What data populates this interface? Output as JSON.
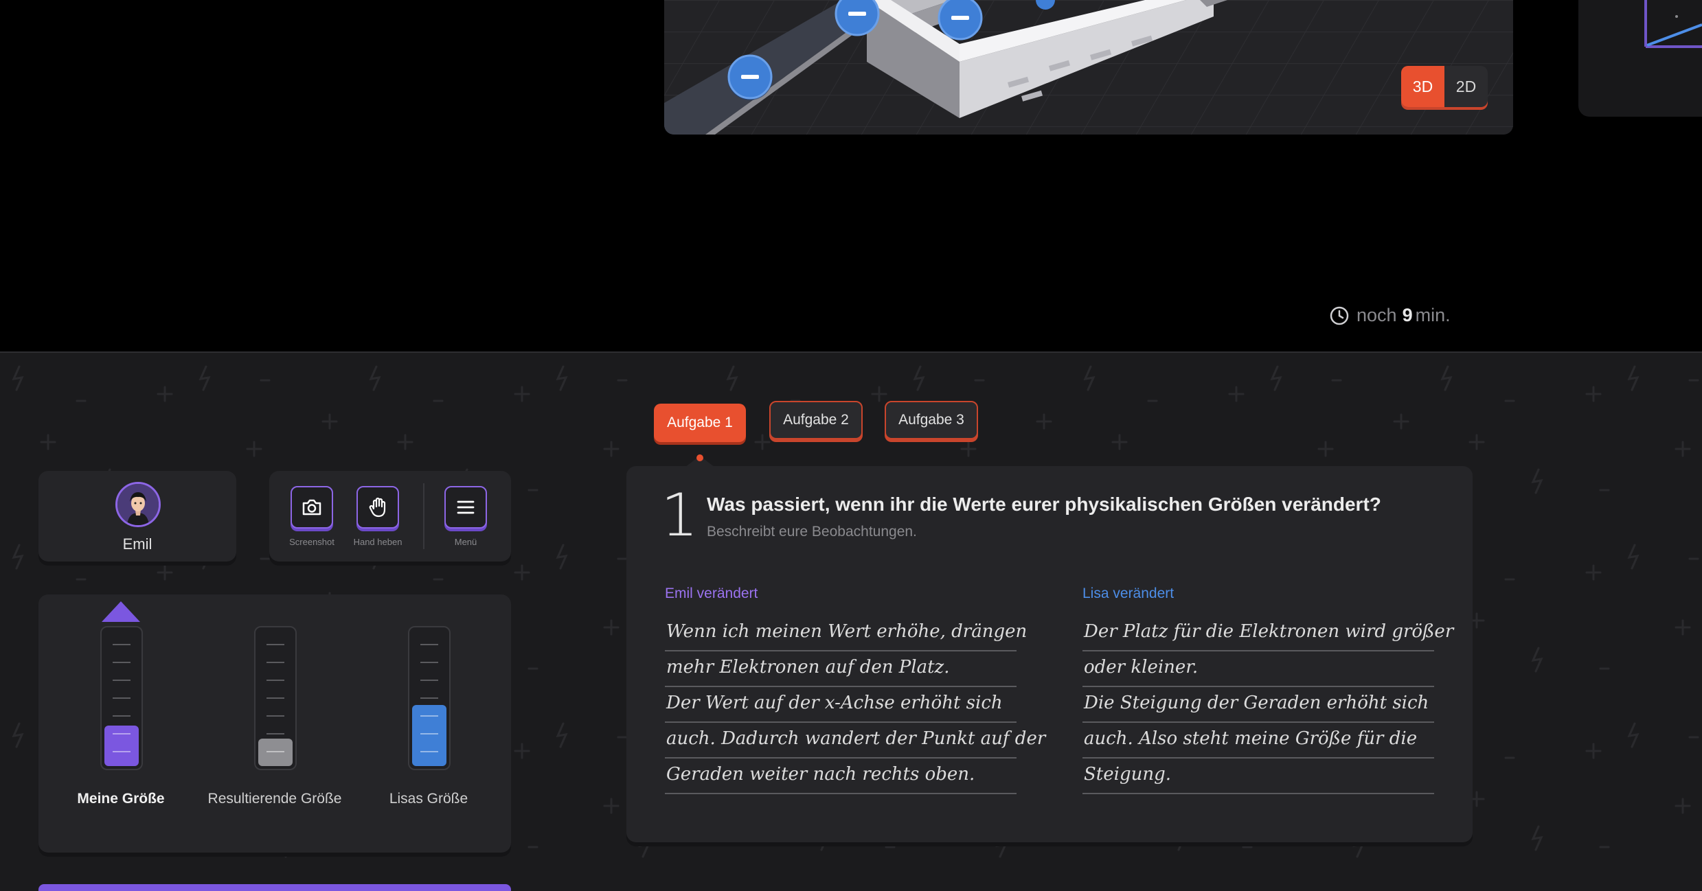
{
  "scene": {
    "view_toggle": {
      "options": [
        "3D",
        "2D"
      ],
      "active": "3D"
    }
  },
  "timer": {
    "prefix": "noch",
    "value": "9",
    "suffix": "min."
  },
  "user": {
    "name": "Emil"
  },
  "tools": [
    {
      "label": "Screenshot",
      "icon": "camera-icon"
    },
    {
      "label": "Hand heben",
      "icon": "hand-icon"
    },
    {
      "label": "Menü",
      "icon": "menu-icon"
    }
  ],
  "sliders": [
    {
      "label": "Meine Größe",
      "level": 0.3,
      "color": "#7b57e0"
    },
    {
      "label": "Resultierende Größe",
      "level": 0.2,
      "color": "#8e8e92"
    },
    {
      "label": "Lisas Größe",
      "level": 0.45,
      "color": "#3f7fd6"
    }
  ],
  "tabs": [
    {
      "label": "Aufgabe 1",
      "active": true
    },
    {
      "label": "Aufgabe 2",
      "active": false
    },
    {
      "label": "Aufgabe 3",
      "active": false
    }
  ],
  "task": {
    "number": "1",
    "question": "Was passiert, wenn ihr die Werte eurer physikalischen Größen verändert?",
    "subtitle": "Beschreibt eure Beobachtungen.",
    "columns": [
      {
        "title": "Emil verändert",
        "color": "#9b73f0",
        "lines": [
          "Wenn ich meinen Wert erhöhe, drängen",
          "mehr Elektronen auf den Platz.",
          "Der Wert auf der x-Achse erhöht sich",
          "auch. Dadurch wandert der Punkt auf der",
          "Geraden weiter nach rechts oben."
        ]
      },
      {
        "title": "Lisa verändert",
        "color": "#4d8ee8",
        "lines": [
          "Der Platz für die Elektronen wird größer",
          "oder kleiner.",
          "Die Steigung der Geraden erhöht sich",
          "auch. Also steht meine Größe für die",
          "Steigung."
        ]
      }
    ]
  },
  "colors": {
    "accent": "#e8502f",
    "purple": "#7b57e0",
    "blue": "#3f7fd6"
  }
}
